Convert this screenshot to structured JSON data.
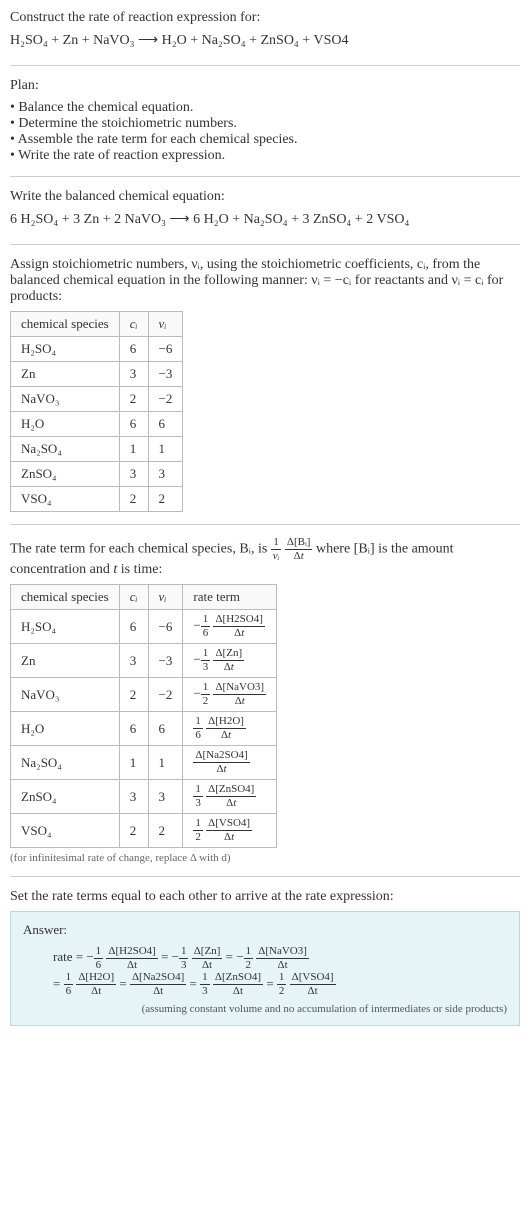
{
  "construct": {
    "title": "Construct the rate of reaction expression for:",
    "equation": "H₂SO₄ + Zn + NaVO₃  ⟶  H₂O + Na₂SO₄ + ZnSO₄ + VSO4"
  },
  "plan": {
    "title": "Plan:",
    "items": [
      "• Balance the chemical equation.",
      "• Determine the stoichiometric numbers.",
      "• Assemble the rate term for each chemical species.",
      "• Write the rate of reaction expression."
    ]
  },
  "balanced": {
    "title": "Write the balanced chemical equation:",
    "equation": "6 H₂SO₄ + 3 Zn + 2 NaVO₃  ⟶  6 H₂O + Na₂SO₄ + 3 ZnSO₄ + 2 VSO₄"
  },
  "stoich": {
    "intro": "Assign stoichiometric numbers, νᵢ, using the stoichiometric coefficients, cᵢ, from the balanced chemical equation in the following manner: νᵢ = −cᵢ for reactants and νᵢ = cᵢ for products:",
    "headers": [
      "chemical species",
      "cᵢ",
      "νᵢ"
    ],
    "rows": [
      [
        "H₂SO₄",
        "6",
        "−6"
      ],
      [
        "Zn",
        "3",
        "−3"
      ],
      [
        "NaVO₃",
        "2",
        "−2"
      ],
      [
        "H₂O",
        "6",
        "6"
      ],
      [
        "Na₂SO₄",
        "1",
        "1"
      ],
      [
        "ZnSO₄",
        "3",
        "3"
      ],
      [
        "VSO₄",
        "2",
        "2"
      ]
    ]
  },
  "rateterm": {
    "intro_part1": "The rate term for each chemical species, Bᵢ, is ",
    "intro_part2": " where [Bᵢ] is the amount concentration and ",
    "intro_part3": " is time:",
    "t_var": "t",
    "headers": [
      "chemical species",
      "cᵢ",
      "νᵢ",
      "rate term"
    ],
    "rows": [
      {
        "species": "H₂SO₄",
        "c": "6",
        "nu": "−6",
        "sign": "−",
        "coef_num": "1",
        "coef_den": "6",
        "delta": "Δ[H2SO4]"
      },
      {
        "species": "Zn",
        "c": "3",
        "nu": "−3",
        "sign": "−",
        "coef_num": "1",
        "coef_den": "3",
        "delta": "Δ[Zn]"
      },
      {
        "species": "NaVO₃",
        "c": "2",
        "nu": "−2",
        "sign": "−",
        "coef_num": "1",
        "coef_den": "2",
        "delta": "Δ[NaVO3]"
      },
      {
        "species": "H₂O",
        "c": "6",
        "nu": "6",
        "sign": "",
        "coef_num": "1",
        "coef_den": "6",
        "delta": "Δ[H2O]"
      },
      {
        "species": "Na₂SO₄",
        "c": "1",
        "nu": "1",
        "sign": "",
        "coef_num": "",
        "coef_den": "",
        "delta": "Δ[Na2SO4]"
      },
      {
        "species": "ZnSO₄",
        "c": "3",
        "nu": "3",
        "sign": "",
        "coef_num": "1",
        "coef_den": "3",
        "delta": "Δ[ZnSO4]"
      },
      {
        "species": "VSO₄",
        "c": "2",
        "nu": "2",
        "sign": "",
        "coef_num": "1",
        "coef_den": "2",
        "delta": "Δ[VSO4]"
      }
    ],
    "note": "(for infinitesimal rate of change, replace Δ with d)"
  },
  "setrate": {
    "title": "Set the rate terms equal to each other to arrive at the rate expression:"
  },
  "answer": {
    "label": "Answer:",
    "rate_label": "rate = ",
    "eq_label": "= ",
    "line1_terms": [
      {
        "sign": "−",
        "num": "1",
        "den": "6",
        "delta": "Δ[H2SO4]"
      },
      {
        "sign": "= −",
        "num": "1",
        "den": "3",
        "delta": "Δ[Zn]"
      },
      {
        "sign": "= −",
        "num": "1",
        "den": "2",
        "delta": "Δ[NaVO3]"
      }
    ],
    "line2_terms": [
      {
        "sign": "",
        "num": "1",
        "den": "6",
        "delta": "Δ[H2O]"
      },
      {
        "sign": "= ",
        "num": "",
        "den": "",
        "delta": "Δ[Na2SO4]"
      },
      {
        "sign": "= ",
        "num": "1",
        "den": "3",
        "delta": "Δ[ZnSO4]"
      },
      {
        "sign": "= ",
        "num": "1",
        "den": "2",
        "delta": "Δ[VSO4]"
      }
    ],
    "dt": "Δt",
    "note": "(assuming constant volume and no accumulation of intermediates or side products)"
  }
}
